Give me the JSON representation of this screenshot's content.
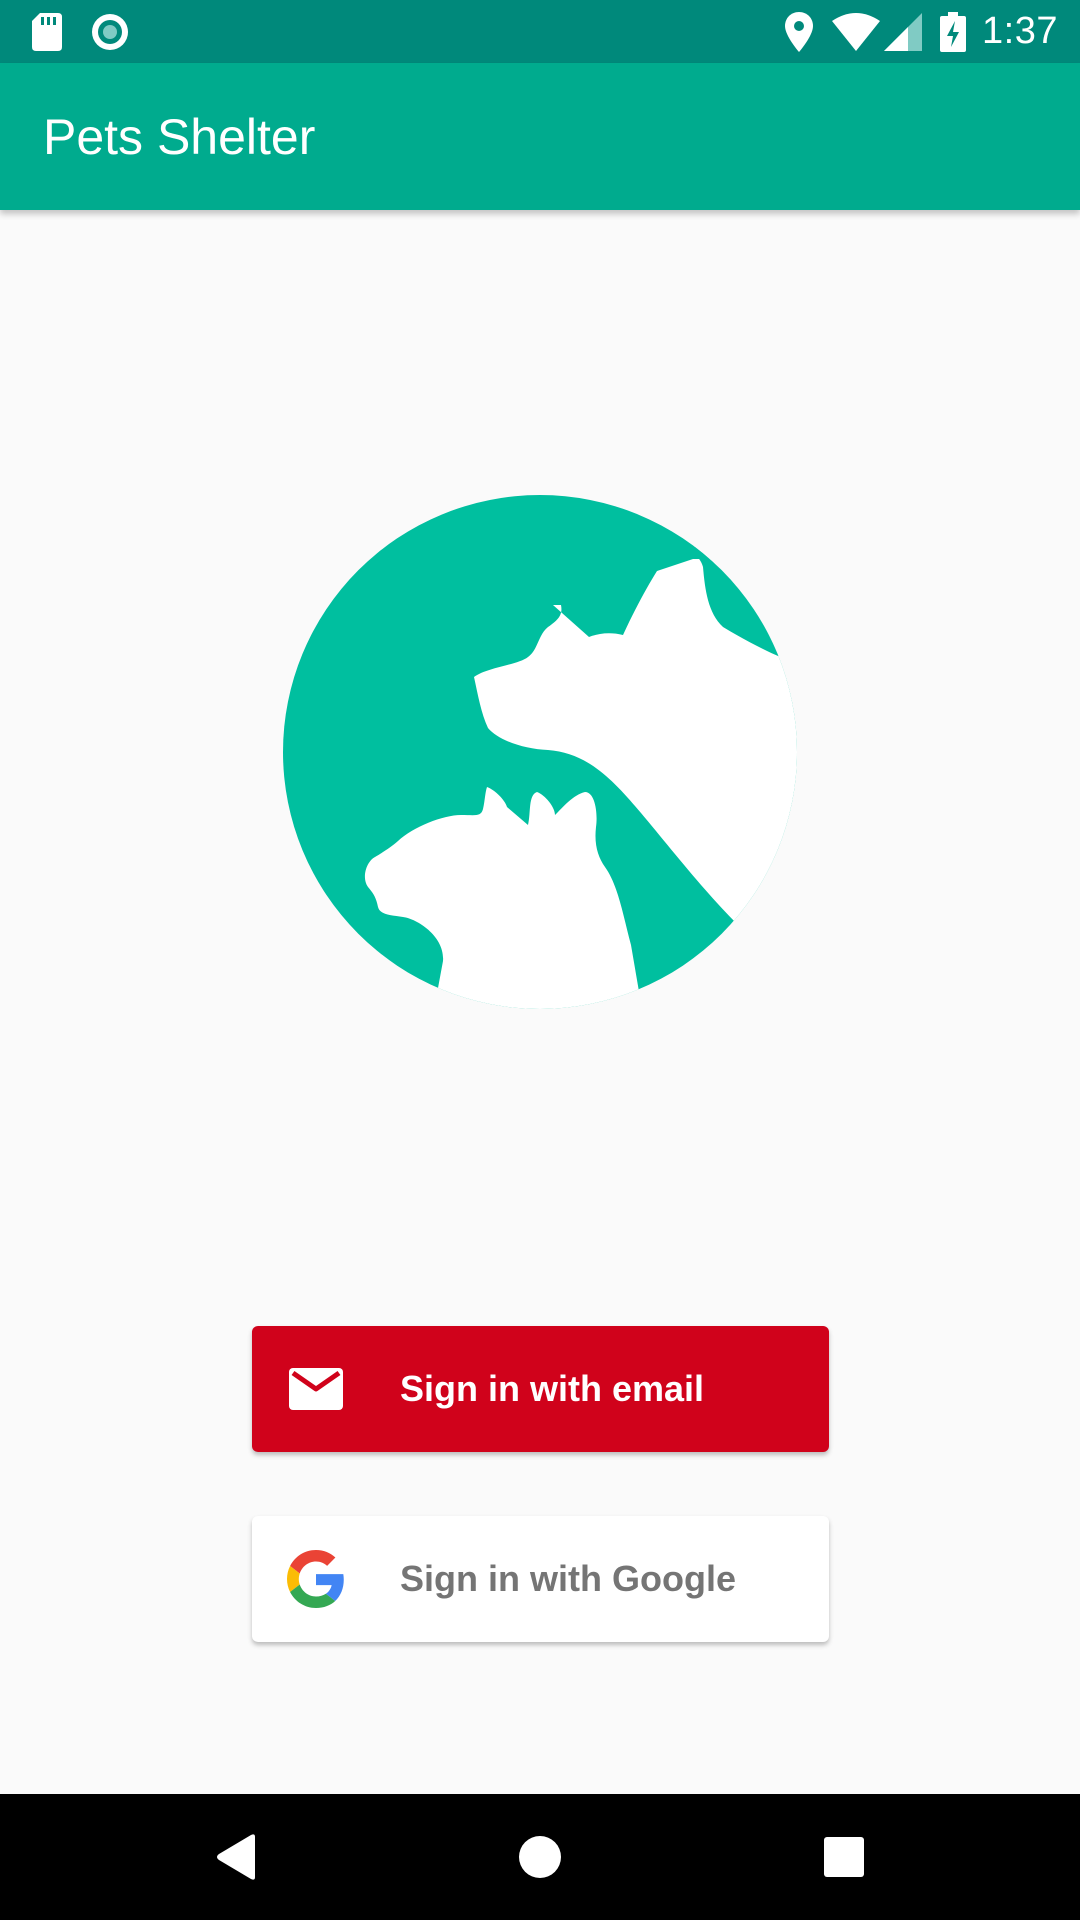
{
  "status_bar": {
    "time": "1:37",
    "left_icons": [
      "sd-card-icon",
      "sync-icon"
    ],
    "right_icons": [
      "location-icon",
      "wifi-icon",
      "signal-icon",
      "battery-charging-icon"
    ]
  },
  "app_bar": {
    "title": "Pets Shelter",
    "color": "#00ab8e"
  },
  "logo": {
    "icon": "pets-logo-icon",
    "color": "#00bf9f"
  },
  "buttons": {
    "email": {
      "label": "Sign in with email",
      "icon": "mail-icon",
      "color": "#d0021b"
    },
    "google": {
      "label": "Sign in with Google",
      "icon": "google-icon",
      "color": "#ffffff"
    }
  },
  "nav_bar": {
    "items": [
      "back-icon",
      "home-icon",
      "recents-icon"
    ]
  }
}
